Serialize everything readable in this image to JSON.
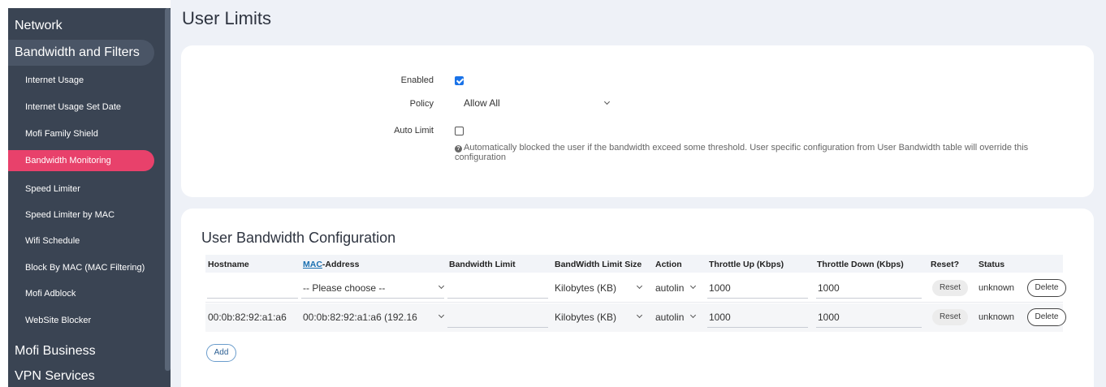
{
  "sidebar": {
    "groups": {
      "network": "Network",
      "bandwidth": "Bandwidth and Filters",
      "business": "Mofi Business",
      "vpn": "VPN Services"
    },
    "items": [
      {
        "label": "Internet Usage"
      },
      {
        "label": "Internet Usage Set Date"
      },
      {
        "label": "Mofi Family Shield"
      },
      {
        "label": "Bandwidth Monitoring",
        "active": true
      },
      {
        "label": "Speed Limiter"
      },
      {
        "label": "Speed Limiter by MAC"
      },
      {
        "label": "Wifi Schedule"
      },
      {
        "label": "Block By MAC (MAC Filtering)"
      },
      {
        "label": "Mofi Adblock"
      },
      {
        "label": "WebSite Blocker"
      }
    ]
  },
  "page": {
    "title": "User Limits"
  },
  "settings": {
    "enabled_label": "Enabled",
    "enabled": true,
    "policy_label": "Policy",
    "policy_value": "Allow All",
    "auto_limit_label": "Auto Limit",
    "auto_limit": false,
    "help_text": "Automatically blocked the user if the bandwidth exceed some threshold. User specific configuration from User Bandwidth table will override this configuration"
  },
  "table": {
    "title": "User Bandwidth Configuration",
    "headers": {
      "hostname": "Hostname",
      "mac_link": "MAC",
      "mac_rest": "-Address",
      "limit": "Bandwidth Limit",
      "size": "BandWidth Limit Size",
      "action": "Action",
      "up": "Throttle Up (Kbps)",
      "down": "Throttle Down (Kbps)",
      "reset": "Reset?",
      "status": "Status"
    },
    "rows": [
      {
        "hostname": "",
        "mac": "-- Please choose --",
        "limit": "",
        "size": "Kilobytes (KB)",
        "action": "autolin",
        "up": "1000",
        "down": "1000",
        "reset": "Reset",
        "status": "unknown",
        "delete": "Delete"
      },
      {
        "hostname": "00:0b:82:92:a1:a6",
        "mac": "00:0b:82:92:a1:a6 (192.16",
        "limit": "",
        "size": "Kilobytes (KB)",
        "action": "autolin",
        "up": "1000",
        "down": "1000",
        "reset": "Reset",
        "status": "unknown",
        "delete": "Delete"
      }
    ],
    "add_label": "Add"
  }
}
